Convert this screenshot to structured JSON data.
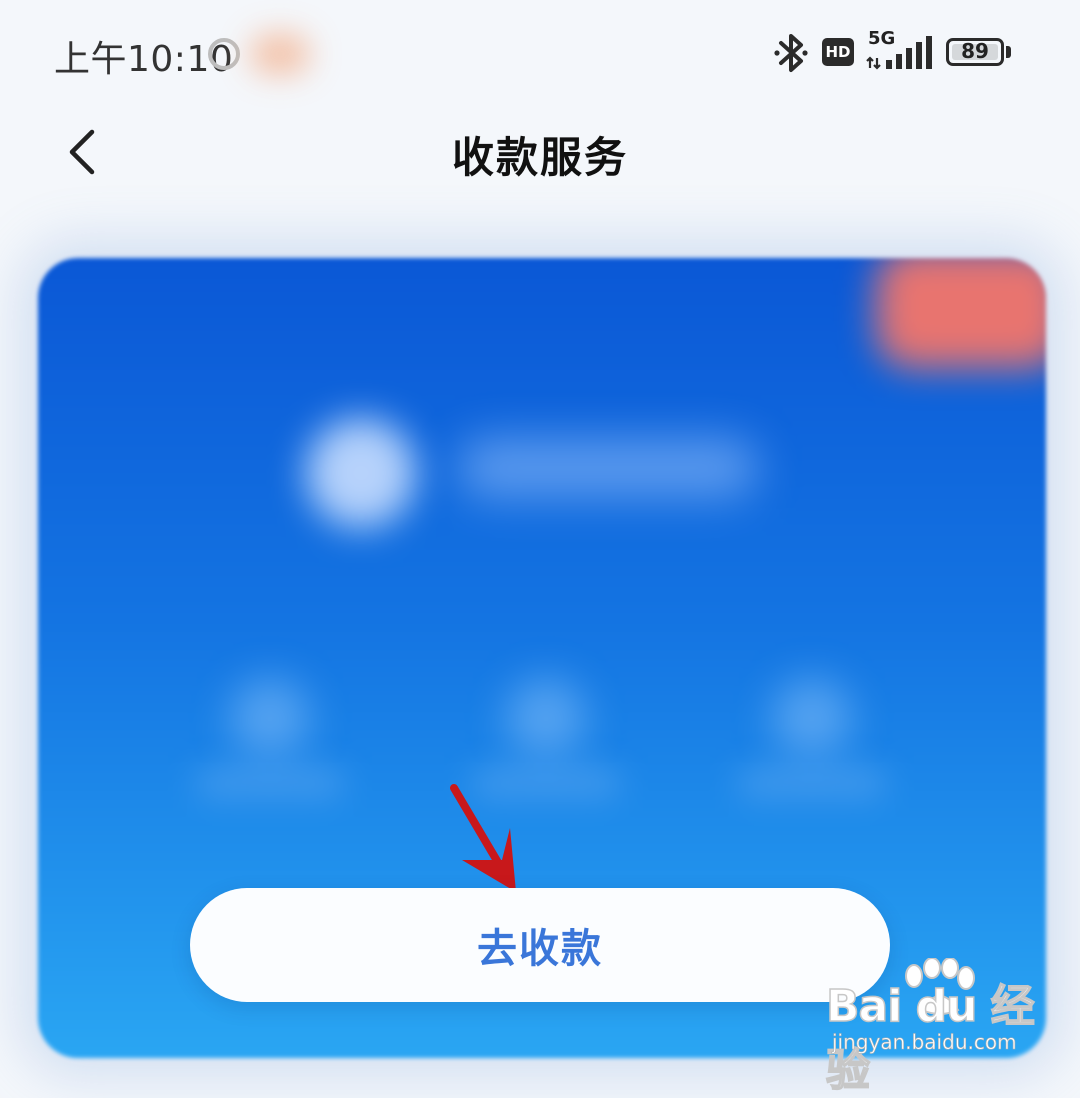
{
  "status_bar": {
    "time": "上午10:10",
    "hd_label": "HD",
    "network_label": "5G",
    "battery_level": "89",
    "icons": [
      "alarm-icon",
      "bluetooth-icon",
      "signal-icon",
      "battery-icon"
    ]
  },
  "nav": {
    "back_icon": "chevron-left-icon",
    "title": "收款服务"
  },
  "main": {
    "collect_button_label": "去收款"
  },
  "watermark": {
    "brand": "Bai du 经验",
    "url": "jingyan.baidu.com"
  },
  "colors": {
    "card_top": "#0b58d6",
    "card_bottom": "#2aa6f3",
    "button_text": "#3a76d9",
    "arrow": "#c8181b"
  }
}
